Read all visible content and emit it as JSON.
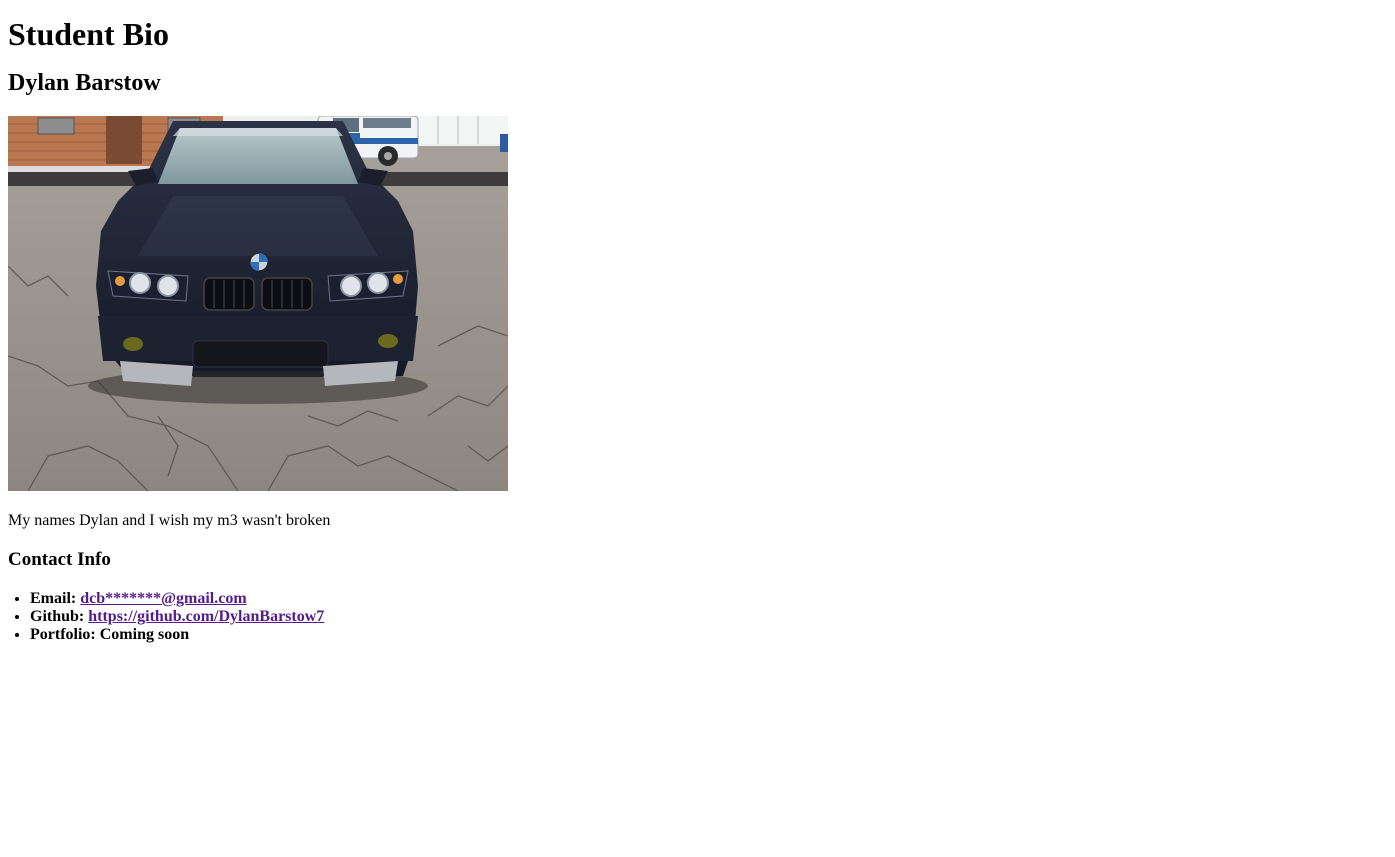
{
  "page": {
    "title": "Student Bio",
    "student_name": "Dylan Barstow",
    "bio": "My names Dylan and I wish my m3 wasn't broken",
    "photo_icon": "car-photo"
  },
  "contact": {
    "heading": "Contact Info",
    "email_label": "Email:",
    "email_value": "dcb*******@gmail.com",
    "github_label": "Github:",
    "github_value": "https://github.com/DylanBarstow7",
    "portfolio_text": "Portfolio: Coming soon"
  },
  "colors": {
    "visited_link": "#551a8b",
    "text": "#000000",
    "background": "#ffffff"
  }
}
